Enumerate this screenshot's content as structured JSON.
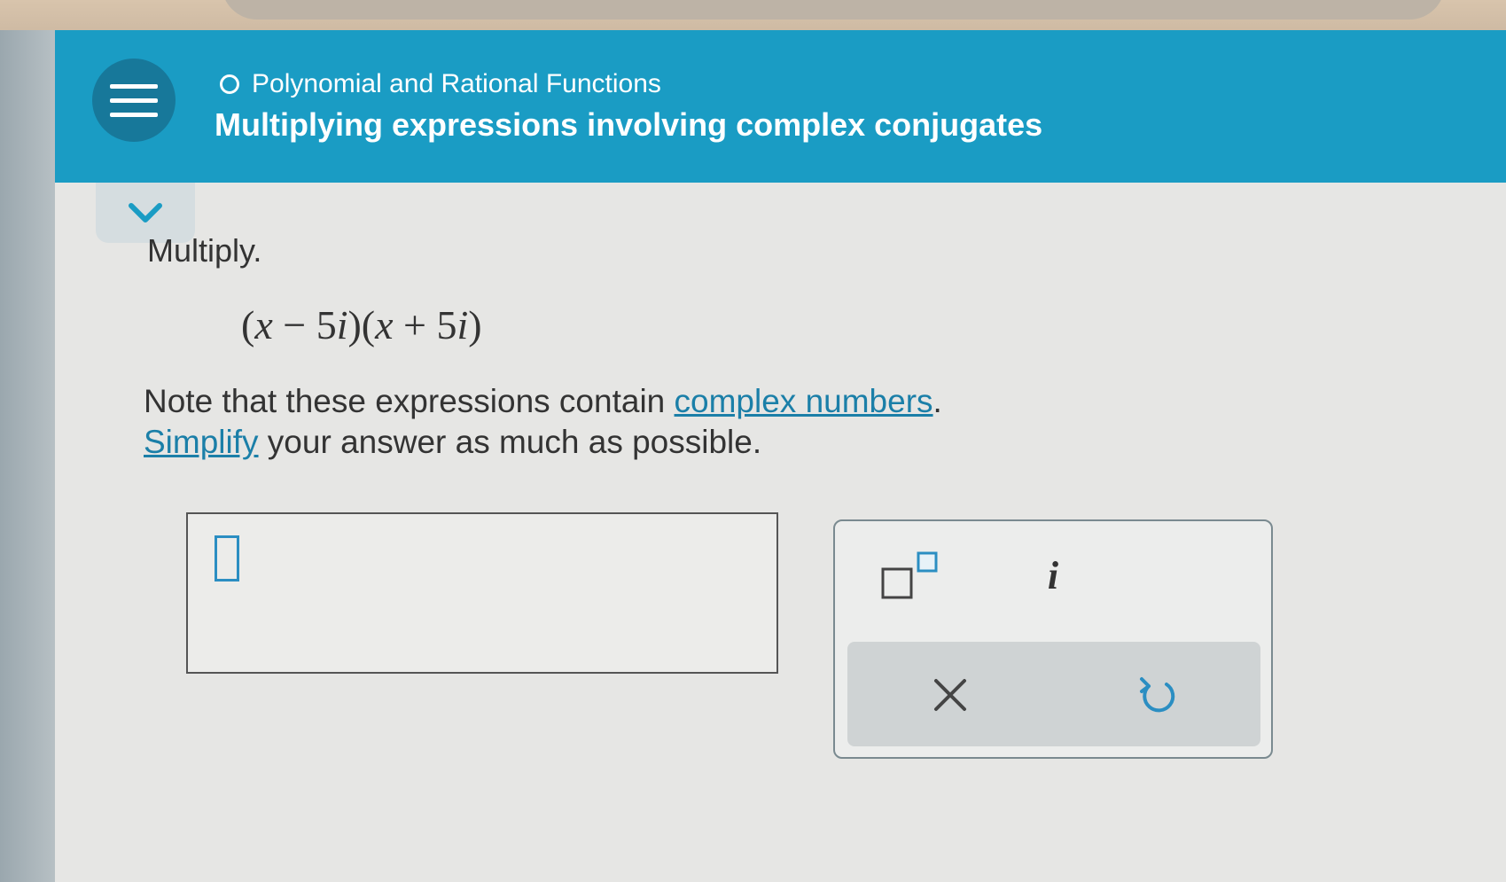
{
  "header": {
    "topic": "Polynomial and Rational Functions",
    "lesson_title": "Multiplying expressions involving complex conjugates"
  },
  "problem": {
    "instruction": "Multiply.",
    "expression": {
      "parts": [
        "(",
        "x",
        " − 5",
        "i",
        ")(",
        "x",
        " + 5",
        "i",
        ")"
      ]
    },
    "note_prefix": "Note that these expressions contain ",
    "note_link": "complex numbers",
    "note_suffix": ".",
    "simplify_link": "Simplify",
    "simplify_suffix": " your answer as much as possible."
  },
  "answer": {
    "value": ""
  },
  "keypad": {
    "imaginary_unit": "i"
  },
  "colors": {
    "header_bg": "#1a9cc4",
    "accent": "#2b8ec2",
    "link": "#1b7fa8"
  },
  "icons": [
    "menu-icon",
    "topic-status-circle-icon",
    "chevron-down-icon",
    "superscript-icon",
    "clear-icon",
    "undo-icon"
  ]
}
